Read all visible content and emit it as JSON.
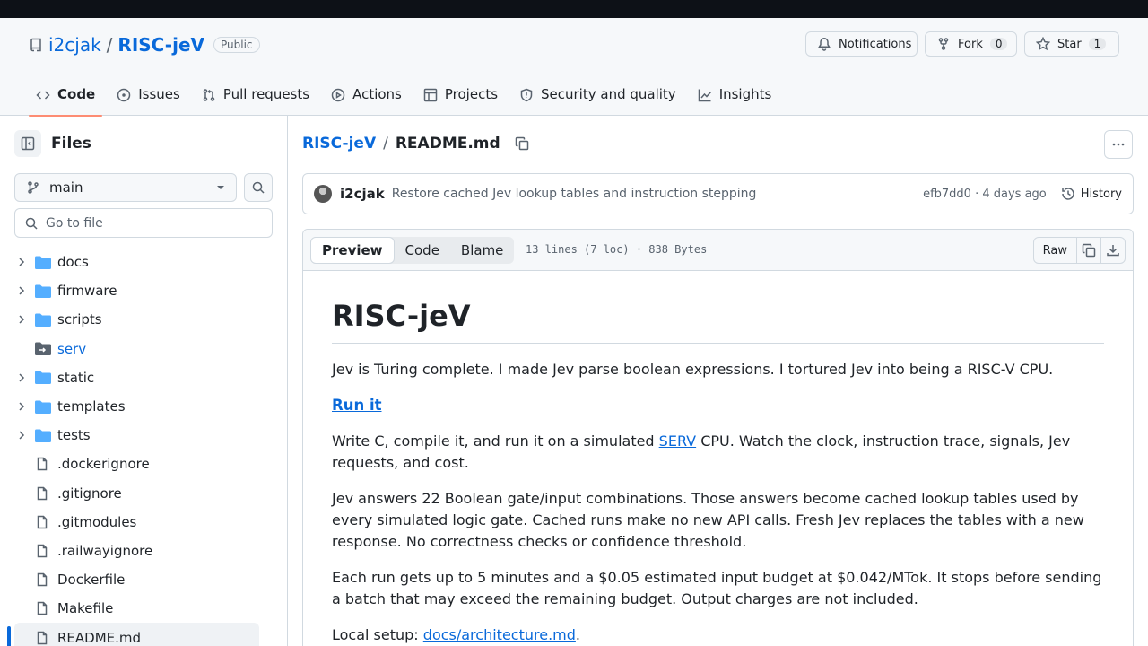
{
  "repo": {
    "owner": "i2cjak",
    "separator": "/",
    "name": "RISC-jeV",
    "visibility": "Public"
  },
  "header_buttons": {
    "notifications": "Notifications",
    "fork": "Fork",
    "fork_count": "0",
    "star": "Star",
    "star_count": "1"
  },
  "tabs": [
    {
      "label": "Code",
      "icon": "code-icon",
      "active": true
    },
    {
      "label": "Issues",
      "icon": "issue-icon"
    },
    {
      "label": "Pull requests",
      "icon": "pull-request-icon"
    },
    {
      "label": "Actions",
      "icon": "play-icon"
    },
    {
      "label": "Projects",
      "icon": "table-icon"
    },
    {
      "label": "Security and quality",
      "icon": "shield-icon"
    },
    {
      "label": "Insights",
      "icon": "graph-icon"
    }
  ],
  "sidebar": {
    "title": "Files",
    "branch": "main",
    "goto_placeholder": "Go to file",
    "tree": [
      {
        "label": "docs",
        "type": "folder"
      },
      {
        "label": "firmware",
        "type": "folder"
      },
      {
        "label": "scripts",
        "type": "folder"
      },
      {
        "label": "serv",
        "type": "submodule"
      },
      {
        "label": "static",
        "type": "folder"
      },
      {
        "label": "templates",
        "type": "folder"
      },
      {
        "label": "tests",
        "type": "folder"
      },
      {
        "label": ".dockerignore",
        "type": "file"
      },
      {
        "label": ".gitignore",
        "type": "file"
      },
      {
        "label": ".gitmodules",
        "type": "file"
      },
      {
        "label": ".railwayignore",
        "type": "file"
      },
      {
        "label": "Dockerfile",
        "type": "file"
      },
      {
        "label": "Makefile",
        "type": "file"
      },
      {
        "label": "README.md",
        "type": "file",
        "selected": true
      }
    ]
  },
  "breadcrumb": {
    "repo": "RISC-jeV",
    "sep": "/",
    "file": "README.md"
  },
  "commit": {
    "author": "i2cjak",
    "message": "Restore cached Jev lookup tables and instruction stepping",
    "meta": "efb7dd0 · 4 days ago",
    "history": "History"
  },
  "file_view": {
    "tabs": [
      "Preview",
      "Code",
      "Blame"
    ],
    "active_tab": "Preview",
    "info": "13 lines (7 loc) · 838 Bytes",
    "raw": "Raw"
  },
  "readme": {
    "title": "RISC-jeV",
    "intro": "Jev is Turing complete. I made Jev parse boolean expressions. I tortured Jev into being a RISC-V CPU.",
    "run_heading": "Run it",
    "run_p_before": "Write C, compile it, and run it on a simulated ",
    "run_p_link": "SERV",
    "run_p_after": " CPU. Watch the clock, instruction trace, signals, Jev requests, and cost.",
    "answers": "Jev answers 22 Boolean gate/input combinations. Those answers become cached lookup tables used by every simulated logic gate. Cached runs make no new API calls. Fresh Jev replaces the tables with a new response. No correctness checks or confidence threshold.",
    "budget": "Each run gets up to 5 minutes and a $0.05 estimated input budget at $0.042/MTok. It stops before sending a batch that may exceed the remaining budget. Output charges are not included.",
    "local_before": "Local setup: ",
    "local_link": "docs/architecture.md",
    "local_after": "."
  },
  "colors": {
    "accent": "#0969da",
    "active_tab_underline": "#fd8c73",
    "folder": "#54aeff",
    "border": "#d1d9e0"
  }
}
